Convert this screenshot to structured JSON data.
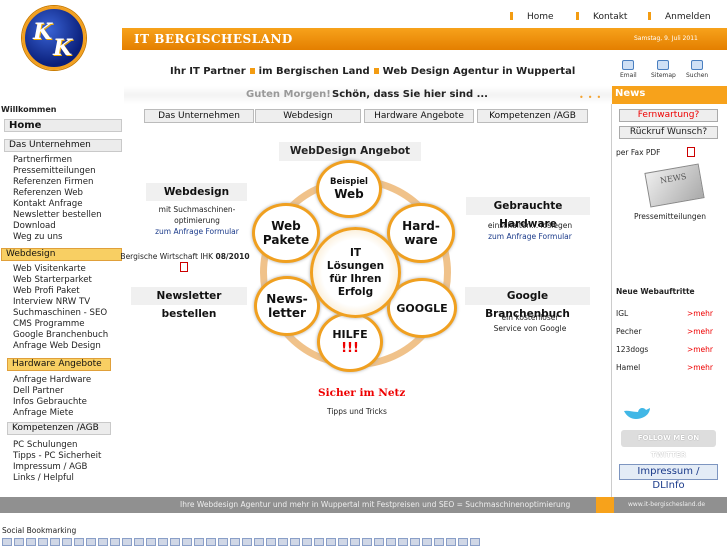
{
  "brand": {
    "logo_text": "KK",
    "site_title": "IT BERGISCHESLAND",
    "date": "Samstag, 9. Juli 2011"
  },
  "topnav": [
    {
      "label": "Home"
    },
    {
      "label": "Kontakt"
    },
    {
      "label": "Anmelden"
    }
  ],
  "tagline": {
    "part1": "Ihr IT Partner",
    "part2": "im Bergischen Land",
    "part3": "Web Design Agentur in Wuppertal"
  },
  "top_icons": [
    {
      "label": "Email",
      "icon": "email-icon"
    },
    {
      "label": "Sitemap",
      "icon": "sitemap-icon"
    },
    {
      "label": "Suchen",
      "icon": "search-icon"
    }
  ],
  "greeting": {
    "part1": "Guten Morgen!",
    "part2": "Schön, dass Sie hier sind ..."
  },
  "news_header": "News",
  "tabs": [
    {
      "label": "Das Unternehmen"
    },
    {
      "label": "Webdesign"
    },
    {
      "label": "Hardware Angebote"
    },
    {
      "label": "Kompetenzen /AGB"
    }
  ],
  "leftnav": {
    "welcome": "Willkommen",
    "home": "Home",
    "sections": [
      {
        "title": "Das Unternehmen",
        "links": [
          "Partnerfirmen",
          "Pressemitteilungen",
          "Referenzen Firmen",
          "Referenzen Web",
          "Kontakt Anfrage",
          "Newsletter bestellen",
          "Download",
          "Weg zu uns"
        ]
      },
      {
        "title": "Webdesign",
        "links": [
          "Web Visitenkarte",
          "Web Starterparket",
          "Web Profi Paket",
          "Interview NRW TV",
          "Suchmaschinen - SEO",
          "CMS Programme",
          "Google Branchenbuch",
          "Anfrage Web Design"
        ]
      },
      {
        "title": "Hardware Angebote",
        "links": [
          "Anfrage Hardware",
          "Dell Partner",
          "Infos Gebrauchte",
          "Anfrage Miete"
        ]
      },
      {
        "title": "Kompetenzen /AGB",
        "links": [
          "PC Schulungen",
          "Tipps - PC Sicherheit",
          "Impressum / AGB",
          "Links / Helpful"
        ]
      }
    ]
  },
  "main": {
    "title": "WebDesign Angebot",
    "webdesign": {
      "title": "Webdesign",
      "text1": "mit Suchmaschinen-",
      "text2": "optimierung",
      "link": "zum Anfrage Formular"
    },
    "wirtschaft": {
      "text": "Bergische Wirtschaft IHK",
      "bold": "08/2010"
    },
    "newsletter": "Newsletter bestellen",
    "hardware": {
      "title": "Gebrauchte Hardware",
      "text": "einschalten... loslegen",
      "link": "zum Anfrage Formular"
    },
    "branchenbuch": {
      "title": "Google Branchenbuch",
      "text1": "ein kostenloser",
      "text2": "Service von Google"
    },
    "circles": {
      "beispiel": {
        "l1": "Beispiel",
        "l2": "Web"
      },
      "webpakete": {
        "l1": "Web",
        "l2": "Pakete"
      },
      "hardware": {
        "l1": "Hard-",
        "l2": "ware"
      },
      "newsletter": {
        "l1": "News-",
        "l2": "letter"
      },
      "google": "GOOGLE",
      "hilfe": {
        "l1": "HILFE",
        "l2": "!!!"
      },
      "center": {
        "l1": "IT",
        "l2": "Lösungen",
        "l3": "für Ihren",
        "l4": "Erfolg"
      }
    },
    "sicher": "Sicher im Netz",
    "tipps": "Tipps und Tricks"
  },
  "right": {
    "fernwartung": "Fernwartung?",
    "rueckruf": "Rückruf Wunsch?",
    "fax": "per Fax PDF",
    "news_img": "NEWS",
    "presse": "Pressemitteilungen",
    "neue": "Neue Webauftritte",
    "auftritte": [
      {
        "name": "IGL",
        "more": ">mehr"
      },
      {
        "name": "Pecher",
        "more": ">mehr"
      },
      {
        "name": "123dogs",
        "more": ">mehr"
      },
      {
        "name": "Hamel",
        "more": ">mehr"
      }
    ],
    "twitter": "FOLLOW ME ON TWITTER",
    "impressum": "Impressum / DLInfo"
  },
  "footer": {
    "text": "Ihre Webdesign Agentur und mehr in Wuppertal mit Festpreisen und SEO = Suchmaschinenoptimierung",
    "url": "www.it-bergischesland.de"
  },
  "social": "Social Bookmarking",
  "colors": {
    "accent": "#f7a21b",
    "highlight": "#e00000",
    "link": "#1a3a8a"
  }
}
